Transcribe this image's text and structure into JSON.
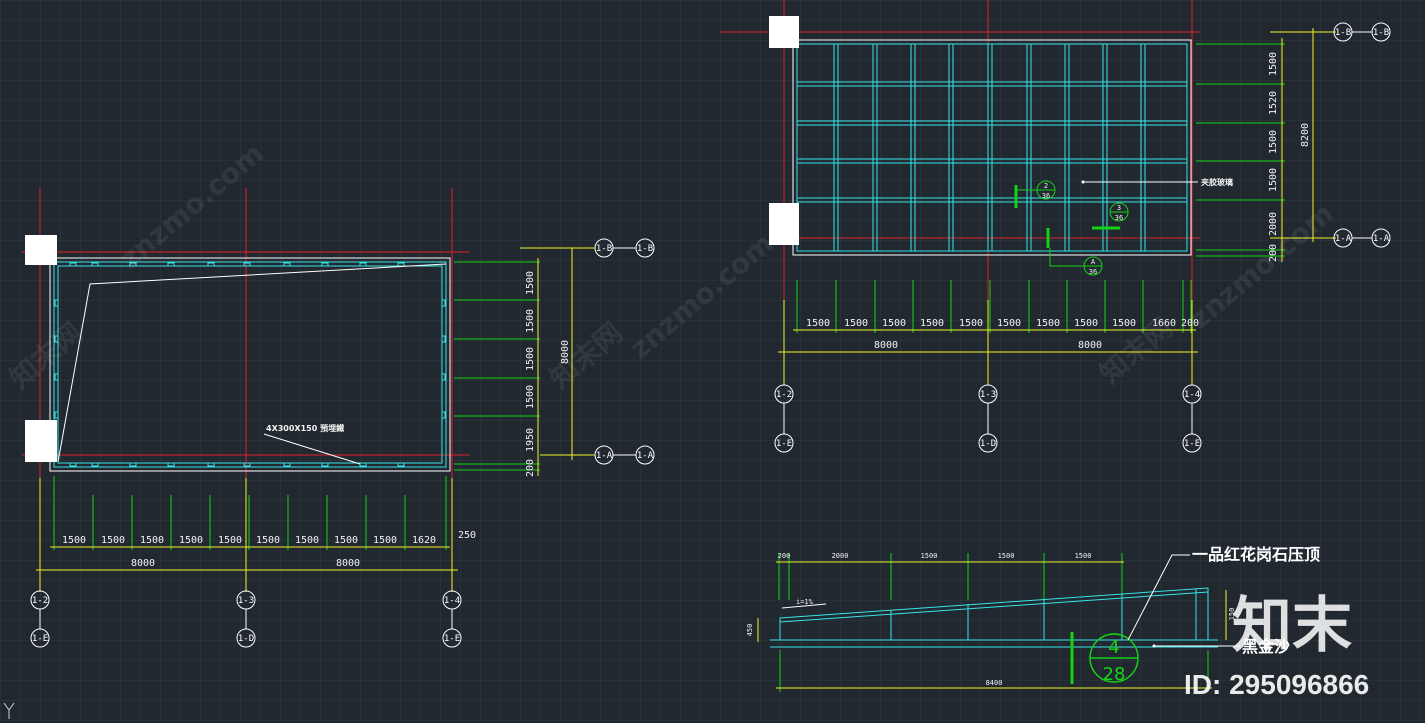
{
  "colors": {
    "background": "#212830",
    "grid": "#2e3740",
    "axis_red": "#e0202a",
    "cyan": "#35e6e6",
    "green": "#14d214",
    "yellow": "#f2f229",
    "white": "#ffffff"
  },
  "plan_left": {
    "dims_bottom": [
      "1500",
      "1500",
      "1500",
      "1500",
      "1500",
      "1500",
      "1500",
      "1500",
      "1500",
      "1620"
    ],
    "dims_bottom_total": [
      "8000",
      "8000"
    ],
    "dim_extra": "250",
    "dims_right": [
      "1500",
      "1500",
      "1500",
      "1500",
      "1950",
      "200"
    ],
    "dim_right_total": "8000",
    "note": "4X300X150 預埋鐵",
    "axes_bottom_a": [
      "1-2",
      "1-3",
      "1-4"
    ],
    "axes_bottom_b": [
      "1-E",
      "1-D",
      "1-E"
    ],
    "axes_right_top": [
      "1-B",
      "1-B"
    ],
    "axes_right_bottom": [
      "1-A",
      "1-A"
    ]
  },
  "plan_right": {
    "dims_bottom": [
      "1500",
      "1500",
      "1500",
      "1500",
      "1500",
      "1500",
      "1500",
      "1500",
      "1500",
      "1660",
      "200"
    ],
    "dims_bottom_total": [
      "8000",
      "8000"
    ],
    "dims_right": [
      "1500",
      "1520",
      "1500",
      "1500",
      "2000",
      "200"
    ],
    "dim_right_total": "8200",
    "note": "夹胶玻璃",
    "detail_a": [
      "2",
      "36"
    ],
    "detail_b": [
      "3",
      "36"
    ],
    "detail_c": [
      "A",
      "36"
    ],
    "axes_bottom_a": [
      "1-2",
      "1-3",
      "1-4"
    ],
    "axes_bottom_b": [
      "1-E",
      "1-D",
      "1-E"
    ],
    "axes_right_top": [
      "1-B",
      "1-B"
    ],
    "axes_right_bottom": [
      "1-A",
      "1-A"
    ]
  },
  "section": {
    "dims_top": [
      "200",
      "2000",
      "1500",
      "1500",
      "1500"
    ],
    "dim_bottom": "8400",
    "slope": "i=1%",
    "dim_left": "450",
    "dim_right": "150",
    "label_top": "一品红花岗石压顶",
    "label_bottom": "黑金沙",
    "detail": [
      "4",
      "28"
    ]
  },
  "watermark": {
    "site": "znzmo.com",
    "cn": "知末网",
    "brand": "知末",
    "id": "ID: 295096866"
  },
  "ucs_icon": "Y"
}
